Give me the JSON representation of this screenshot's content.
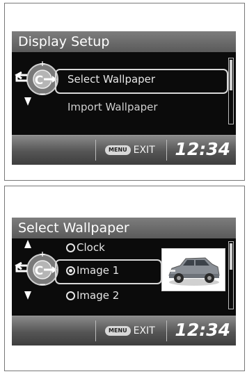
{
  "display_setup": {
    "title": "Display Setup",
    "items": [
      {
        "label": "Select Wallpaper",
        "selected": true
      },
      {
        "label": "Import Wallpaper",
        "selected": false
      }
    ],
    "menu_badge": "MENU",
    "exit_label": "EXIT",
    "clock": "12:34"
  },
  "select_wallpaper": {
    "title": "Select Wallpaper",
    "options": [
      {
        "label": "Clock",
        "checked": false
      },
      {
        "label": "Image 1",
        "checked": true
      },
      {
        "label": "Image 2",
        "checked": false
      }
    ],
    "menu_badge": "MENU",
    "exit_label": "EXIT",
    "clock": "12:34"
  },
  "colors": {
    "screen_bg": "#0b0b0b",
    "title_bar": "#6b6b6b",
    "text": "#e6e6e6"
  },
  "icons": [
    "interface-dial-icon",
    "back-arrow-icon",
    "down-arrow-icon",
    "up-arrow-icon",
    "car-thumbnail"
  ]
}
